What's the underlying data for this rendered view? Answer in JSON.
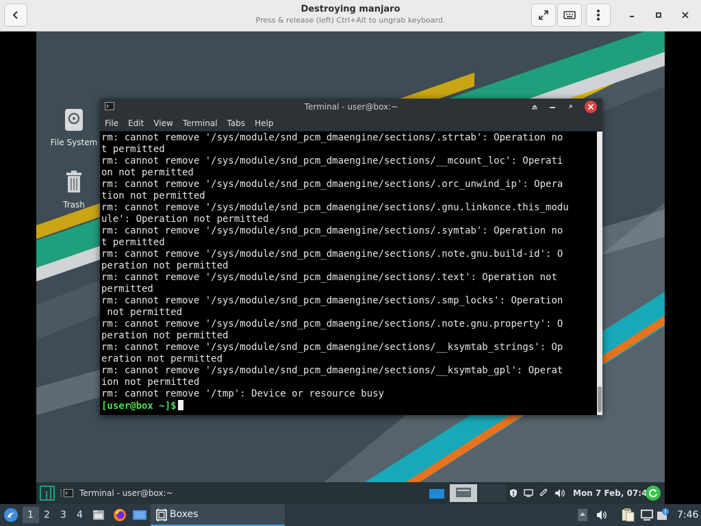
{
  "header": {
    "title": "Destroying manjaro",
    "subtitle": "Press & release (left) Ctrl+Alt to ungrab keyboard."
  },
  "desktop": {
    "icons": [
      {
        "label": "File System",
        "icon": "drive-icon"
      },
      {
        "label": "Trash",
        "icon": "trash-icon"
      }
    ]
  },
  "terminal": {
    "title": "Terminal - user@box:~",
    "menu": [
      "File",
      "Edit",
      "View",
      "Terminal",
      "Tabs",
      "Help"
    ],
    "lines": [
      "rm: cannot remove '/sys/module/snd_pcm_dmaengine/sections/.strtab': Operation no",
      "t permitted",
      "rm: cannot remove '/sys/module/snd_pcm_dmaengine/sections/__mcount_loc': Operati",
      "on not permitted",
      "rm: cannot remove '/sys/module/snd_pcm_dmaengine/sections/.orc_unwind_ip': Opera",
      "tion not permitted",
      "rm: cannot remove '/sys/module/snd_pcm_dmaengine/sections/.gnu.linkonce.this_modu",
      "ule': Operation not permitted",
      "rm: cannot remove '/sys/module/snd_pcm_dmaengine/sections/.symtab': Operation no",
      "t permitted",
      "rm: cannot remove '/sys/module/snd_pcm_dmaengine/sections/.note.gnu.build-id': O",
      "peration not permitted",
      "rm: cannot remove '/sys/module/snd_pcm_dmaengine/sections/.text': Operation not",
      "permitted",
      "rm: cannot remove '/sys/module/snd_pcm_dmaengine/sections/.smp_locks': Operation",
      " not permitted",
      "rm: cannot remove '/sys/module/snd_pcm_dmaengine/sections/.note.gnu.property': O",
      "peration not permitted",
      "rm: cannot remove '/sys/module/snd_pcm_dmaengine/sections/__ksymtab_strings': Op",
      "eration not permitted",
      "rm: cannot remove '/sys/module/snd_pcm_dmaengine/sections/__ksymtab_gpl': Operat",
      "ion not permitted",
      "rm: cannot remove '/tmp': Device or resource busy"
    ],
    "prompt": "[user@box ~]$"
  },
  "guest_panel": {
    "task_label": "Terminal - user@box:~",
    "clock": "Mon  7 Feb, 07:45"
  },
  "host_taskbar": {
    "workspaces": [
      "1",
      "2",
      "3",
      "4"
    ],
    "active_task": "Boxes",
    "clock": "7:46"
  },
  "colors": {
    "terminal_bg": "#000000",
    "prompt_green": "#4ee04e",
    "manjaro_teal": "#1f9f7c",
    "close_red": "#e0403f",
    "accent_blue": "#3da5e0"
  }
}
